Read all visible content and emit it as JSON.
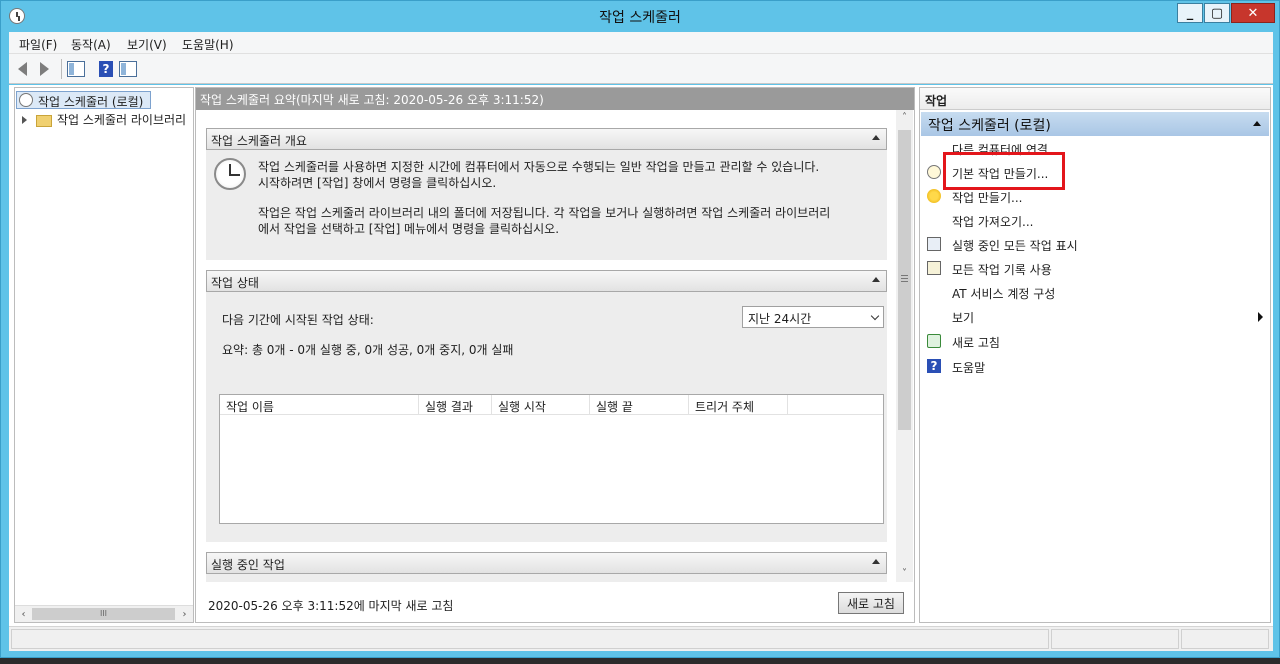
{
  "window": {
    "title": "작업 스케줄러"
  },
  "menu": [
    "파일(F)",
    "동작(A)",
    "보기(V)",
    "도움말(H)"
  ],
  "toolbar": {
    "back": "back-icon",
    "forward": "forward-icon",
    "panel": "show-hide-console-tree-icon",
    "help": "help-icon",
    "panel2": "show-hide-action-pane-icon"
  },
  "tree": {
    "root": "작업 스케줄러 (로컬)",
    "child": "작업 스케줄러 라이브러리"
  },
  "center": {
    "header": "작업 스케줄러 요약(마지막 새로 고침: 2020-05-26 오후 3:11:52)",
    "overview": {
      "title": "작업 스케줄러 개요",
      "line1": "작업 스케줄러를 사용하면 지정한 시간에 컴퓨터에서 자동으로 수행되는 일반 작업을 만들고 관리할 수 있습니다.",
      "line2": "시작하려면 [작업] 창에서 명령을 클릭하십시오.",
      "line3": "작업은 작업 스케줄러 라이브러리 내의 폴더에 저장됩니다. 각 작업을 보거나 실행하려면 작업 스케줄러 라이브러리",
      "line4": "에서 작업을 선택하고 [작업] 메뉴에서 명령을 클릭하십시오."
    },
    "status": {
      "title": "작업 상태",
      "period_label": "다음 기간에 시작된 작업 상태:",
      "period_value": "지난 24시간",
      "summary": "요약: 총 0개 - 0개 실행 중, 0개 성공, 0개 중지, 0개 실패",
      "columns": [
        "작업 이름",
        "실행 결과",
        "실행 시작",
        "실행 끝",
        "트리거 주체"
      ]
    },
    "running": {
      "title": "실행 중인 작업"
    },
    "footer": {
      "refresh_text": "2020-05-26 오후 3:11:52에 마지막 새로 고침",
      "refresh_button": "새로 고침"
    }
  },
  "actions": {
    "header": "작업",
    "group": "작업 스케줄러 (로컬)",
    "items": [
      {
        "label": "다른 컴퓨터에 연결...",
        "icon": ""
      },
      {
        "label": "기본 작업 만들기...",
        "icon": "basic-task-wizard-icon"
      },
      {
        "label": "작업 만들기...",
        "icon": "create-task-icon"
      },
      {
        "label": "작업 가져오기...",
        "icon": ""
      },
      {
        "label": "실행 중인 모든 작업 표시",
        "icon": "running-tasks-icon"
      },
      {
        "label": "모든 작업 기록 사용",
        "icon": "task-history-icon"
      },
      {
        "label": "AT 서비스 계정 구성",
        "icon": ""
      },
      {
        "label": "보기",
        "icon": ""
      },
      {
        "label": "새로 고침",
        "icon": "refresh-icon"
      },
      {
        "label": "도움말",
        "icon": "help-icon"
      }
    ]
  },
  "colors": {
    "titlebar": "#5fc3e8",
    "highlight": "#e3161b",
    "action_group": "#a9c6e5"
  }
}
